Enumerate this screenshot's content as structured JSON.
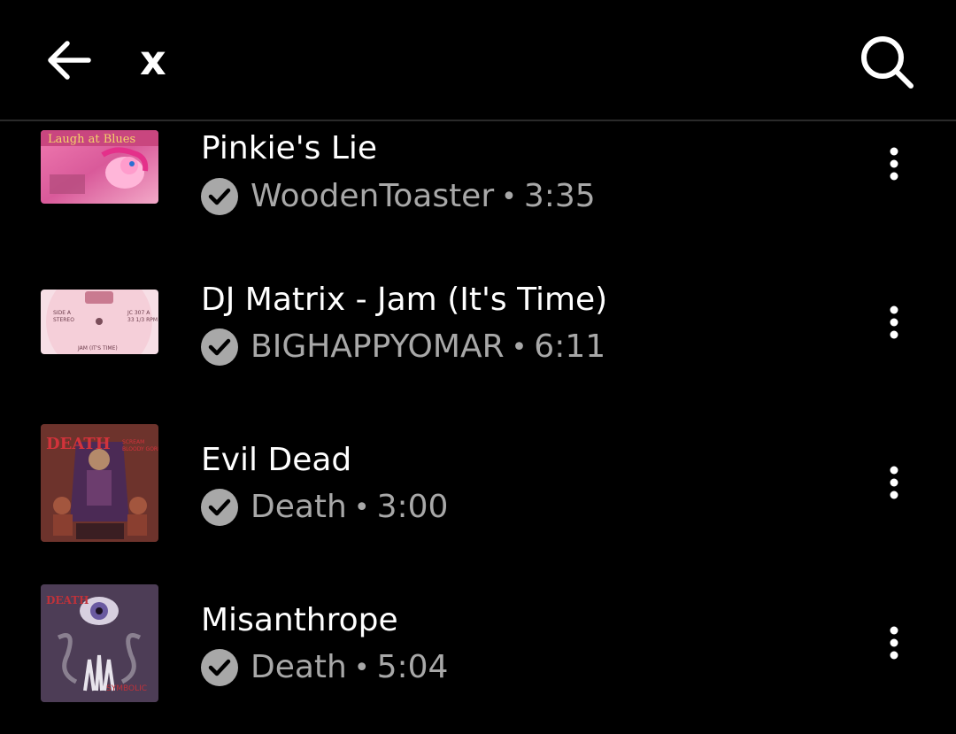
{
  "header": {
    "back_icon": "arrow-left-icon",
    "query": "x",
    "search_icon": "search-icon"
  },
  "results": [
    {
      "title": "Pinkie's Lie",
      "artist": "WoodenToaster",
      "duration": "3:35",
      "verified_icon": "check-circle-icon",
      "more_icon": "more-vert-icon",
      "artwork": "album-art-pinkie"
    },
    {
      "title": "DJ Matrix - Jam (It's Time)",
      "artist": "BIGHAPPYOMAR",
      "duration": "6:11",
      "verified_icon": "check-circle-icon",
      "more_icon": "more-vert-icon",
      "artwork": "album-art-vinyl-label"
    },
    {
      "title": "Evil Dead",
      "artist": "Death",
      "duration": "3:00",
      "verified_icon": "check-circle-icon",
      "more_icon": "more-vert-icon",
      "artwork": "album-art-scream-bloody-gore"
    },
    {
      "title": "Misanthrope",
      "artist": "Death",
      "duration": "5:04",
      "verified_icon": "check-circle-icon",
      "more_icon": "more-vert-icon",
      "artwork": "album-art-symbolic"
    }
  ],
  "separator": "•",
  "colors": {
    "background": "#000000",
    "primary_text": "#ffffff",
    "secondary_text": "#a8a8a8",
    "divider": "#2a2a2a"
  }
}
